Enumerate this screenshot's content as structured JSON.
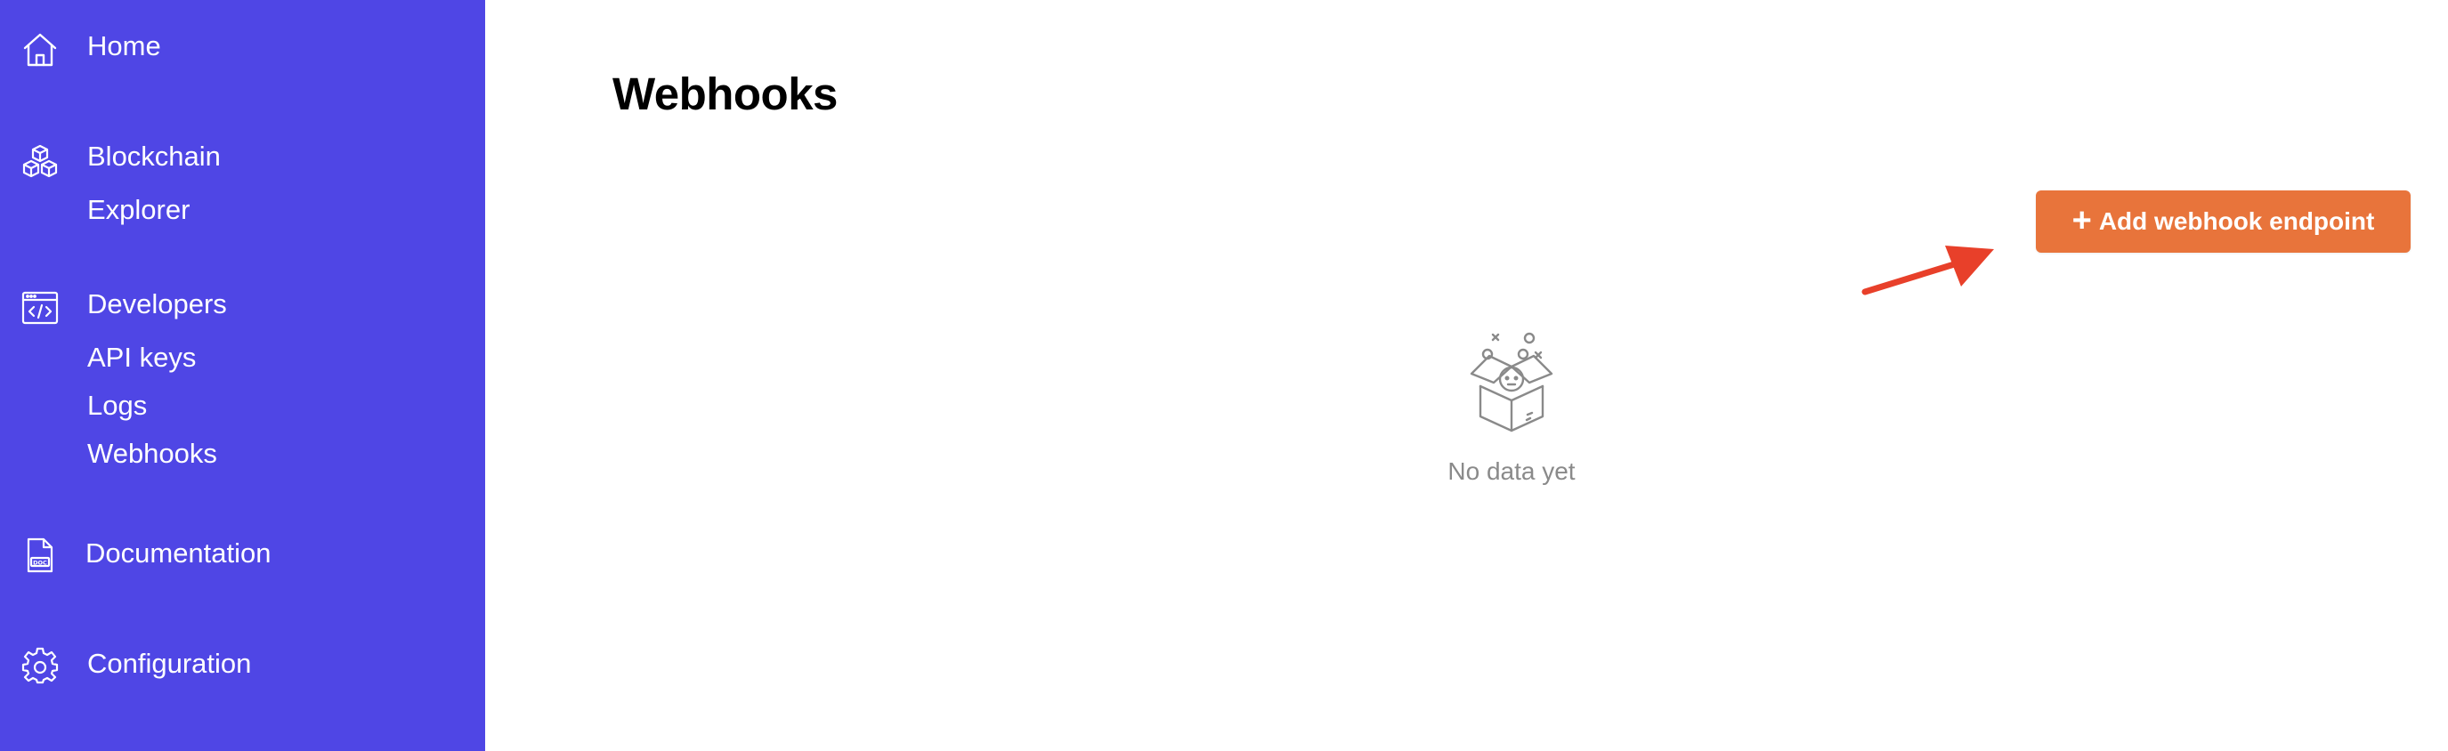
{
  "sidebar": {
    "home": {
      "label": "Home",
      "icon": "home-icon"
    },
    "blockchain": {
      "label": "Blockchain",
      "sub": "Explorer",
      "icon": "cubes-icon"
    },
    "developers": {
      "label": "Developers",
      "icon": "code-window-icon",
      "items": [
        {
          "label": "API keys"
        },
        {
          "label": "Logs"
        },
        {
          "label": "Webhooks"
        }
      ]
    },
    "documentation": {
      "label": "Documentation",
      "icon": "doc-file-icon"
    },
    "configuration": {
      "label": "Configuration",
      "icon": "gear-icon"
    }
  },
  "main": {
    "title": "Webhooks",
    "add_button": {
      "label": "Add webhook endpoint",
      "icon": "plus-icon"
    },
    "empty_state": {
      "text": "No data yet",
      "icon": "empty-box-icon"
    }
  },
  "colors": {
    "sidebar_bg": "#4f46e5",
    "button_bg": "#e8743b",
    "annotation_arrow": "#e8402a",
    "empty_text": "#8a8a8a"
  }
}
